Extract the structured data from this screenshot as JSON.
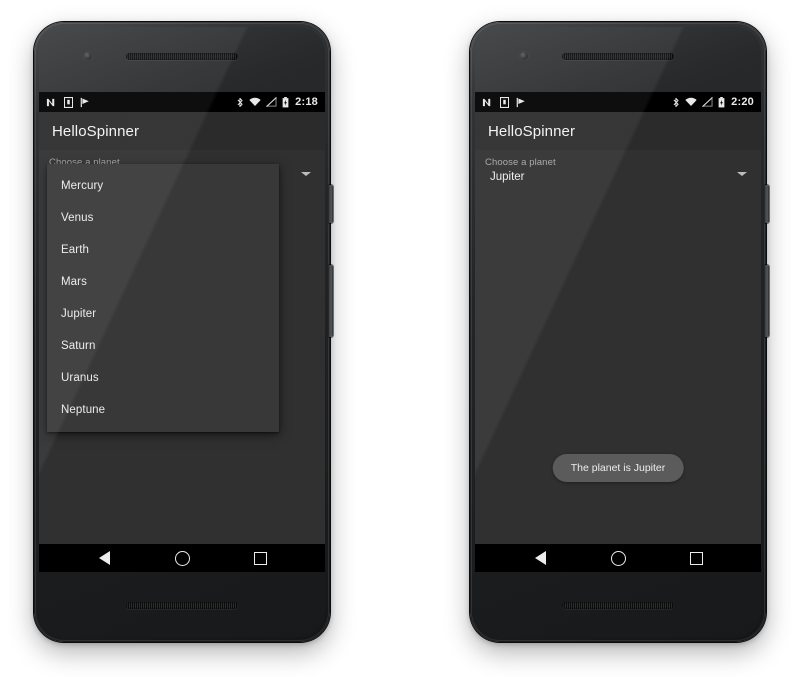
{
  "app": {
    "title": "HelloSpinner",
    "spinner_label": "Choose a planet",
    "planets": [
      "Mercury",
      "Venus",
      "Earth",
      "Mars",
      "Jupiter",
      "Saturn",
      "Uranus",
      "Neptune"
    ]
  },
  "colors": {
    "screen_background": "#303030",
    "action_bar": "#2b2b2b",
    "status_bar": "#000000",
    "dropdown_panel": "#383838",
    "toast_background": "#5b5b5b",
    "primary_text": "#ededed",
    "secondary_text": "#a6a6a6"
  },
  "phones": [
    {
      "name": "left-phone-dropdown-open",
      "status_bar": {
        "left_icons": [
          "android-n-icon",
          "device-icon",
          "play-flag-icon"
        ],
        "right_icons": [
          "bluetooth-icon",
          "wifi-icon",
          "no-signal-icon",
          "battery-icon"
        ],
        "time": "2:18"
      },
      "title": "HelloSpinner",
      "spinner_label": "Choose a planet",
      "spinner_value": "Mercury",
      "dropdown_open": true,
      "dropdown_items": [
        "Mercury",
        "Venus",
        "Earth",
        "Mars",
        "Jupiter",
        "Saturn",
        "Uranus",
        "Neptune"
      ],
      "toast": null,
      "nav_bar": [
        "back-button",
        "home-button",
        "recents-button"
      ]
    },
    {
      "name": "right-phone-selection-made",
      "status_bar": {
        "left_icons": [
          "android-n-icon",
          "device-icon",
          "play-flag-icon"
        ],
        "right_icons": [
          "bluetooth-icon",
          "wifi-icon",
          "no-signal-icon",
          "battery-icon"
        ],
        "time": "2:20"
      },
      "title": "HelloSpinner",
      "spinner_label": "Choose a planet",
      "spinner_value": "Jupiter",
      "dropdown_open": false,
      "dropdown_items": [],
      "toast": "The planet is Jupiter",
      "nav_bar": [
        "back-button",
        "home-button",
        "recents-button"
      ]
    }
  ]
}
